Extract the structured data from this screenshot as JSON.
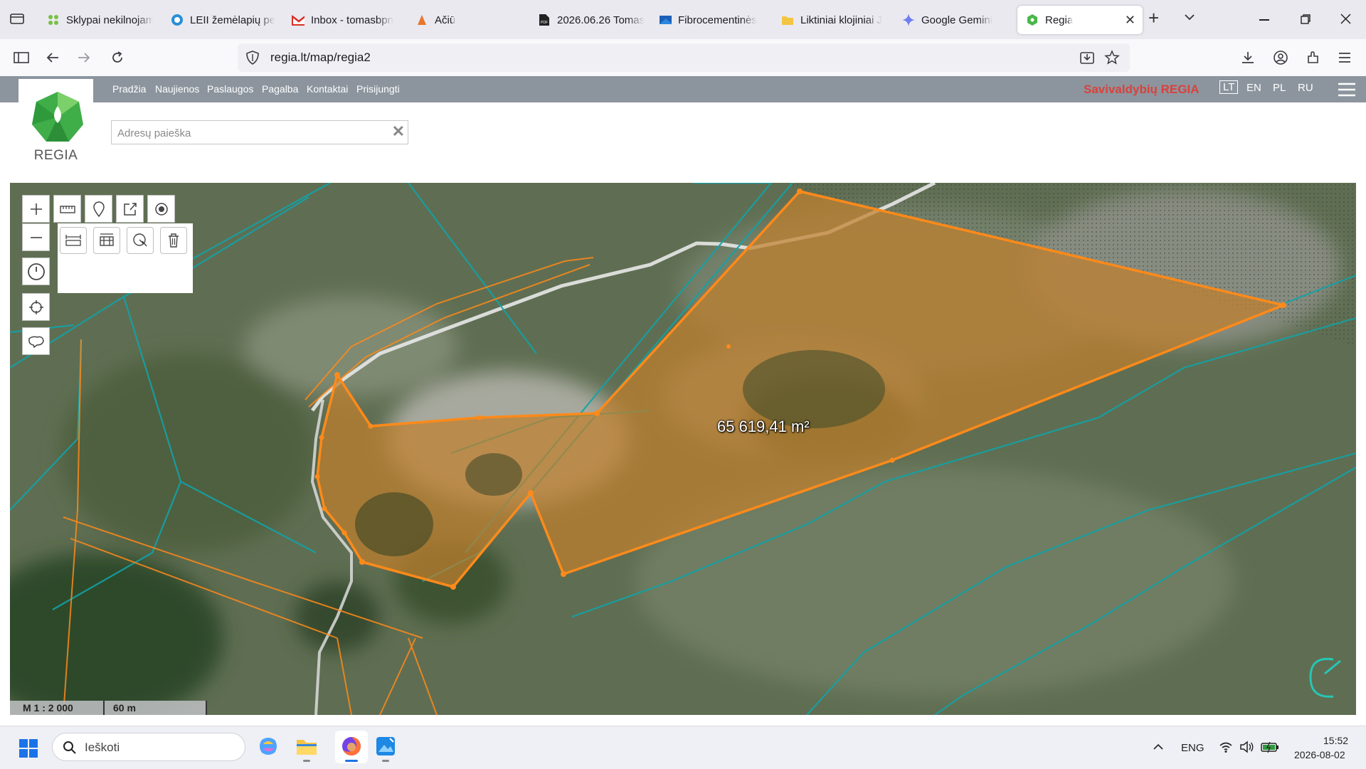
{
  "browser": {
    "tabs": [
      {
        "label": "Sklypai nekilnojam",
        "icon": "sklypai-favicon"
      },
      {
        "label": "LEII žemėlapių pe",
        "icon": "leii-favicon"
      },
      {
        "label": "Inbox - tomasbpn",
        "icon": "gmail-favicon"
      },
      {
        "label": "Ačiū",
        "icon": "aciu-favicon"
      },
      {
        "label": "2026.06.26 Tomas",
        "icon": "pdf-favicon"
      },
      {
        "label": "Fibrocementinės",
        "icon": "fibro-favicon"
      },
      {
        "label": "Liktiniai klojiniai J",
        "icon": "folder-favicon"
      },
      {
        "label": "Google Gemini",
        "icon": "gemini-favicon"
      },
      {
        "label": "Regia",
        "icon": "regia-favicon",
        "active": true
      }
    ],
    "url": "regia.lt/map/regia2"
  },
  "site": {
    "menu": [
      "Pradžia",
      "Naujienos",
      "Paslaugos",
      "Pagalba",
      "Kontaktai",
      "Prisijungti"
    ],
    "brand": "Savivaldybių REGIA",
    "languages": [
      "LT",
      "EN",
      "PL",
      "RU"
    ],
    "active_language": "LT",
    "logo_text": "REGIA",
    "search": {
      "placeholder": "Adresų paieška",
      "value": ""
    }
  },
  "map": {
    "area_label": "65 619,41 m²",
    "scale_ratio": "M 1 : 2 000",
    "scale_distance": "60 m",
    "colors": {
      "parcel_fill": "#c07f2c",
      "parcel_stroke": "#ff8a1a",
      "cadastre_line": "#11a3a8"
    }
  },
  "taskbar": {
    "search_placeholder": "Ieškoti",
    "language": "ENG",
    "time": "15:52",
    "date": "2026-08-02"
  }
}
